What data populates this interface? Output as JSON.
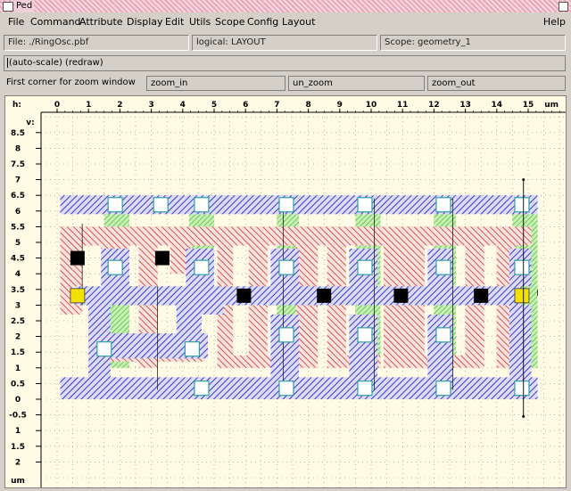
{
  "window": {
    "title": "Ped"
  },
  "menu": {
    "items": [
      "File",
      "Command",
      "Attribute",
      "Display",
      "Edit",
      "Utils",
      "Scope",
      "Config",
      "Layout"
    ],
    "help": "Help"
  },
  "status": {
    "file": "File: ./RingOsc.pbf",
    "logical": "logical: LAYOUT",
    "scope": "Scope: geometry_1"
  },
  "command_line": "(auto-scale) (redraw)",
  "prompt": "First corner for zoom window",
  "buttons": {
    "zoom_in": "zoom_in",
    "un_zoom": "un_zoom",
    "zoom_out": "zoom_out"
  },
  "axes": {
    "x_axis_label": "h:",
    "x_unit": "um",
    "y_axis_label": "v:",
    "y_unit": "um",
    "x_ticks": [
      "0",
      "1",
      "2",
      "3",
      "4",
      "5",
      "6",
      "7",
      "8",
      "9",
      "10",
      "11",
      "12",
      "13",
      "14",
      "15"
    ],
    "y_ticks": [
      "8.5",
      "8",
      "7.5",
      "7",
      "6.5",
      "6",
      "5.5",
      "5",
      "4.5",
      "4",
      "3.5",
      "3",
      "2.5",
      "2",
      "1.5",
      "1",
      "0.5",
      "0",
      "-0.5",
      "1",
      "1.5",
      "2"
    ]
  },
  "colors": {
    "canvas_bg": "#fffbe4",
    "metal": "#3a3ad0",
    "poly": "#d03030",
    "diffusion": "#30b030",
    "contact": "#000000",
    "port": "#f2e000",
    "grid": "#707070"
  }
}
